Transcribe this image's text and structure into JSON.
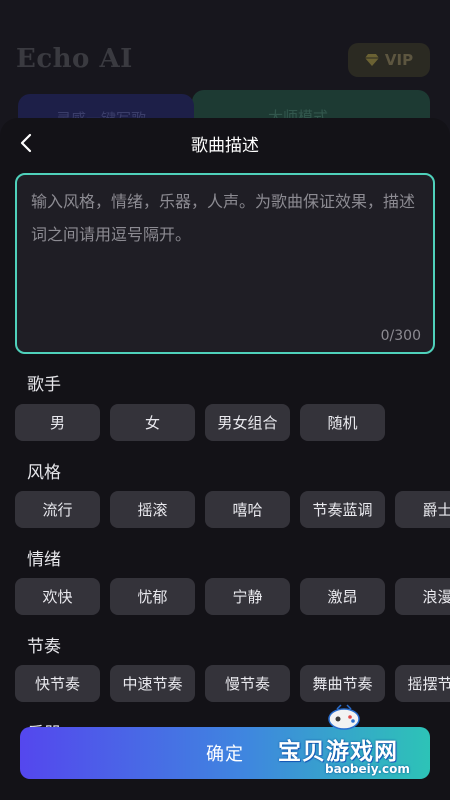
{
  "background": {
    "app_title": "Echo AI",
    "vip_label": "VIP",
    "tab_inspiration": "灵感一键写歌",
    "tab_master": "大师模式"
  },
  "sheet": {
    "title": "歌曲描述",
    "description": {
      "value": "",
      "placeholder": "输入风格，情绪，乐器，人声。为歌曲保证效果，描述词之间请用逗号隔开。",
      "counter": "0/300"
    },
    "sections": {
      "singer": {
        "label": "歌手",
        "options": [
          "男",
          "女",
          "男女组合",
          "随机"
        ]
      },
      "style": {
        "label": "风格",
        "options": [
          "流行",
          "摇滚",
          "嘻哈",
          "节奏蓝调",
          "爵士"
        ]
      },
      "mood": {
        "label": "情绪",
        "options": [
          "欢快",
          "忧郁",
          "宁静",
          "激昂",
          "浪漫"
        ]
      },
      "rhythm": {
        "label": "节奏",
        "options": [
          "快节奏",
          "中速节奏",
          "慢节奏",
          "舞曲节奏",
          "摇摆节奏"
        ]
      },
      "instrument": {
        "label": "乐器"
      }
    },
    "confirm_label": "确定"
  },
  "watermark": {
    "title": "宝贝游戏网",
    "url": "baobeiy.com"
  },
  "colors": {
    "accent_border": "#4fd1bb",
    "chip_bg": "#34333a",
    "button_gradient_start": "#5447ee",
    "button_gradient_end": "#2dc3b7"
  }
}
